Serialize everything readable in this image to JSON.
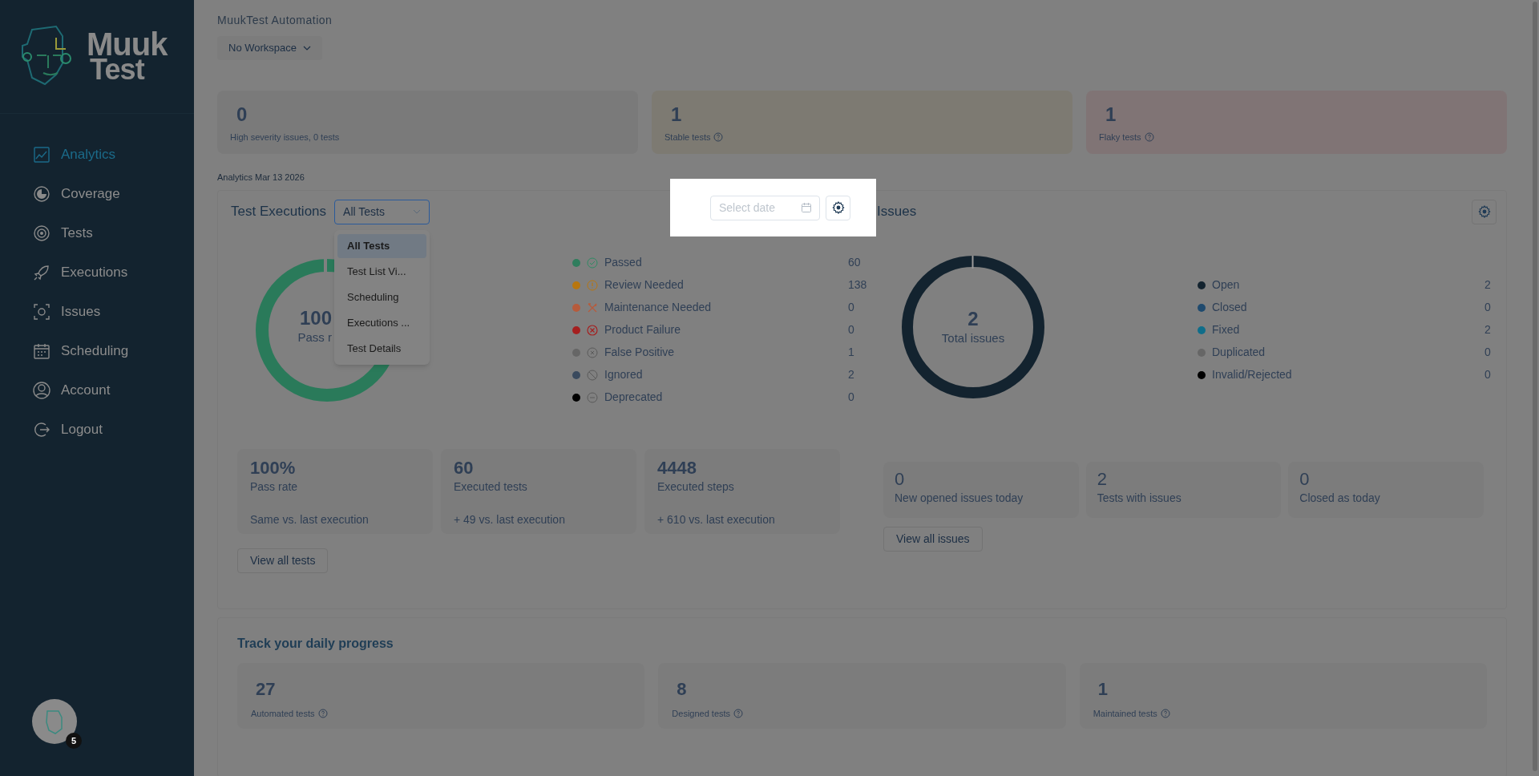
{
  "sidebar": {
    "logo": {
      "line_1": "Muuk",
      "line_2": "Test"
    },
    "items": [
      {
        "label": "Analytics",
        "selected": true
      },
      {
        "label": "Coverage",
        "selected": false
      },
      {
        "label": "Tests",
        "selected": false
      },
      {
        "label": "Executions",
        "selected": false
      },
      {
        "label": "Issues",
        "selected": false
      },
      {
        "label": "Scheduling",
        "selected": false
      },
      {
        "label": "Account",
        "selected": false
      },
      {
        "label": "Logout",
        "selected": false
      }
    ],
    "avatar": {
      "badge": "5"
    }
  },
  "header": {
    "title": "MuukTest Automation",
    "workspace_button": "No Workspace"
  },
  "summary_cards": [
    {
      "value": "0",
      "label": "High severity issues, 0 tests",
      "info_icon": false,
      "color": "#7a7a7a"
    },
    {
      "value": "1",
      "label": "Stable tests",
      "info_icon": true,
      "color": "#7d7a72"
    },
    {
      "value": "1",
      "label": "Flaky tests",
      "info_icon": true,
      "color": "#807475"
    }
  ],
  "analytics_date": "Analytics Mar 13 2026",
  "test_executions": {
    "title": "Test Executions",
    "filter": {
      "value": "All Tests",
      "expanded": true,
      "options": [
        {
          "label": "All Tests",
          "selected": true
        },
        {
          "label": "Test List Vi...",
          "selected": false
        },
        {
          "label": "Scheduling",
          "selected": false
        },
        {
          "label": "Executions ...",
          "selected": false
        },
        {
          "label": "Test Details",
          "selected": false
        }
      ]
    },
    "date_field": {
      "placeholder": "Select date"
    },
    "donut": {
      "value": "100",
      "label": "Pass r"
    },
    "legend": [
      {
        "label": "Passed",
        "count": "60",
        "color": "#2f7d5d"
      },
      {
        "label": "Review Needed",
        "count": "138",
        "color": "#b8760f"
      },
      {
        "label": "Maintenance Needed",
        "count": "0",
        "color": "#b65b3c"
      },
      {
        "label": "Product Failure",
        "count": "0",
        "color": "#a51f1f"
      },
      {
        "label": "False Positive",
        "count": "1",
        "color": "#666666"
      },
      {
        "label": "Ignored",
        "count": "2",
        "color": "#3a4a5e"
      },
      {
        "label": "Deprecated",
        "count": "0",
        "color": "#000000"
      }
    ],
    "stats": [
      {
        "value": "100%",
        "label": "Pass rate",
        "note": "Same vs. last execution"
      },
      {
        "value": "60",
        "label": "Executed tests",
        "note": "+ 49 vs. last execution"
      },
      {
        "value": "4448",
        "label": "Executed steps",
        "note": "+ 610 vs. last execution"
      }
    ],
    "button": "View all tests"
  },
  "issues": {
    "title": "Issues",
    "donut": {
      "value": "2",
      "label": "Total issues"
    },
    "legend": [
      {
        "label": "Open",
        "count": "2",
        "color": "#13232f"
      },
      {
        "label": "Closed",
        "count": "0",
        "color": "#1f4a6e"
      },
      {
        "label": "Fixed",
        "count": "2",
        "color": "#0f6d8a"
      },
      {
        "label": "Duplicated",
        "count": "0",
        "color": "#666666"
      },
      {
        "label": "Invalid/Rejected",
        "count": "0",
        "color": "#000000"
      }
    ],
    "stats": [
      {
        "value": "0",
        "label": "New opened issues today"
      },
      {
        "value": "2",
        "label": "Tests with issues"
      },
      {
        "value": "0",
        "label": "Closed as today"
      }
    ],
    "button": "View all issues"
  },
  "daily_progress": {
    "title": "Track your daily progress",
    "cards": [
      {
        "value": "27",
        "label": "Automated tests",
        "info_icon": true
      },
      {
        "value": "8",
        "label": "Designed tests",
        "info_icon": true
      },
      {
        "value": "1",
        "label": "Maintained tests",
        "info_icon": true
      }
    ]
  }
}
